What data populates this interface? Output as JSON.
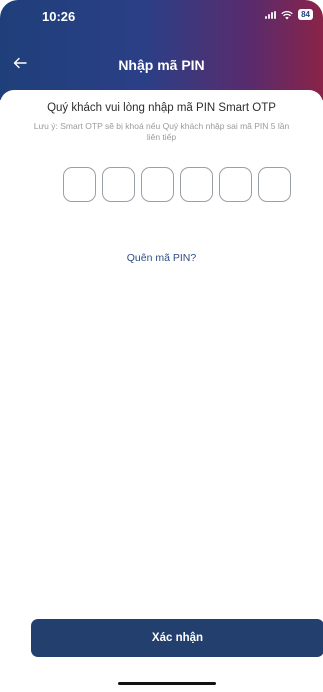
{
  "status_bar": {
    "time": "10:26",
    "battery": "84"
  },
  "header": {
    "title": "Nhập mã PIN",
    "background_colors": [
      "#1f3f7a",
      "#5a2b6c",
      "#8a2348"
    ]
  },
  "content": {
    "instruction": "Quý khách vui lòng nhập mã PIN Smart OTP",
    "note": "Lưu ý: Smart OTP sẽ bị khoá nếu Quý khách nhập sai mã PIN 5 lần liên tiếp",
    "pin_fields": [
      "",
      "",
      "",
      "",
      "",
      ""
    ],
    "forgot_pin": "Quên mã PIN?"
  },
  "footer": {
    "confirm_label": "Xác nhận",
    "button_color": "#233f6e"
  },
  "icons": {
    "back": "arrow-left-icon",
    "signal": "signal-icon",
    "wifi": "wifi-icon"
  }
}
